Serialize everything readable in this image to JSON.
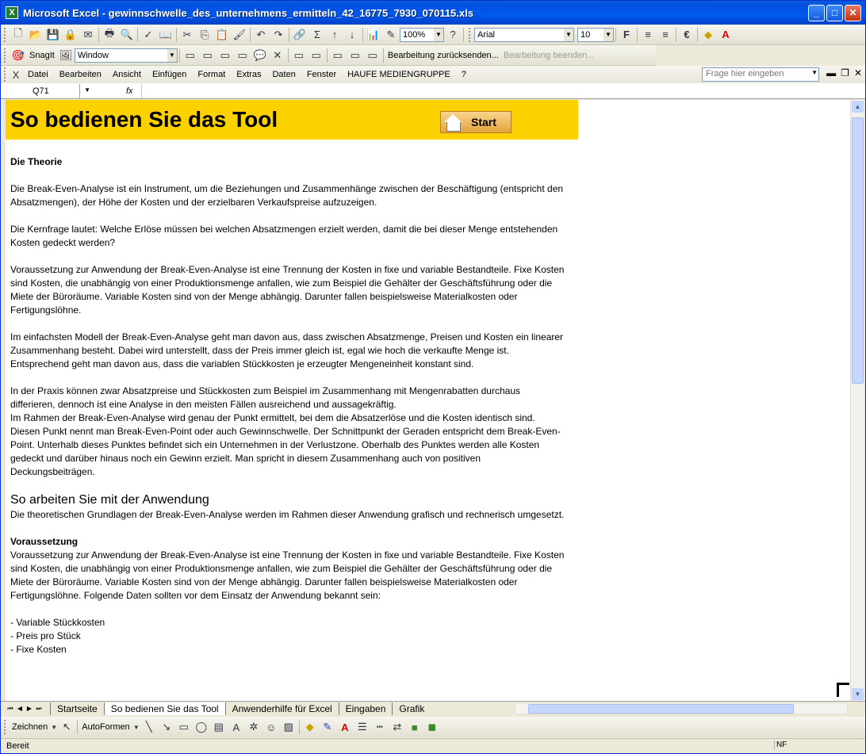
{
  "window": {
    "title": "Microsoft Excel - gewinnschwelle_des_unternehmens_ermitteln_42_16775_7930_070115.xls"
  },
  "toolbar": {
    "zoom": "100%",
    "font": "Arial",
    "font_size": "10",
    "bold_label": "F"
  },
  "snagit_bar": {
    "snagit_label": "SnagIt",
    "window_combo": "Window",
    "review_label": "Bearbeitung zurücksenden...",
    "end_review_label": "Bearbeitung beenden..."
  },
  "menu": {
    "items": [
      "Datei",
      "Bearbeiten",
      "Ansicht",
      "Einfügen",
      "Format",
      "Extras",
      "Daten",
      "Fenster",
      "HAUFE MEDIENGRUPPE",
      "?"
    ],
    "help_placeholder": "Frage hier eingeben"
  },
  "formula_bar": {
    "cell": "Q71",
    "fx": "fx",
    "value": ""
  },
  "banner": {
    "title": "So bedienen Sie das Tool",
    "start_label": "Start"
  },
  "content": {
    "theory_heading": "Die Theorie",
    "p1": "Die Break-Even-Analyse ist ein Instrument, um die Beziehungen und Zusammenhänge zwischen der Beschäftigung (entspricht den Absatzmengen), der Höhe der Kosten und der erzielbaren Verkaufspreise aufzuzeigen.",
    "p2": "Die Kernfrage lautet: Welche Erlöse müssen bei welchen Absatzmengen erzielt werden, damit die bei dieser Menge entstehenden Kosten gedeckt werden?",
    "p3": "Voraussetzung zur Anwendung der Break-Even-Analyse ist eine Trennung der Kosten in fixe und variable Bestandteile. Fixe Kosten sind Kosten, die unabhängig von einer Produktionsmenge anfallen, wie zum Beispiel die Gehälter der Geschäftsführung oder die Miete der Büroräume. Variable Kosten sind von der Menge abhängig. Darunter fallen beispielsweise Materialkosten oder Fertigungslöhne.",
    "p4": "Im einfachsten Modell der Break-Even-Analyse geht man davon aus, dass zwischen Absatzmenge, Preisen und Kosten ein linearer Zusammenhang besteht. Dabei wird unterstellt, dass der Preis immer gleich ist, egal wie hoch die verkaufte Menge ist. Entsprechend geht man davon aus, dass die variablen Stückkosten je erzeugter Mengeneinheit konstant sind.",
    "p5": "In der Praxis können zwar Absatzpreise und Stückkosten zum Beispiel im Zusammenhang mit Mengenrabatten durchaus differieren, dennoch ist eine Analyse in den meisten Fällen ausreichend und aussagekräftig.",
    "p6": "Im Rahmen der Break-Even-Analyse wird genau der Punkt ermittelt, bei dem die Absatzerlöse und die Kosten identisch sind. Diesen Punkt nennt man Break-Even-Point oder auch Gewinnschwelle. Der Schnittpunkt der Geraden entspricht dem Break-Even-Point. Unterhalb dieses Punktes befindet sich ein Unternehmen in der Verlustzone. Oberhalb des Punktes werden alle Kosten gedeckt und darüber hinaus noch ein Gewinn erzielt. Man spricht in diesem Zusammenhang auch von positiven Deckungsbeiträgen.",
    "app_heading": "So arbeiten Sie mit der Anwendung",
    "p7": "Die theoretischen Grundlagen der Break-Even-Analyse werden im Rahmen dieser Anwendung grafisch und rechnerisch umgesetzt.",
    "prereq_heading": "Voraussetzung",
    "p8": "Voraussetzung zur Anwendung der Break-Even-Analyse ist eine Trennung der Kosten in fixe und variable Bestandteile. Fixe Kosten sind Kosten, die unabhängig von einer Produktionsmenge anfallen, wie zum Beispiel die Gehälter der Geschäftsführung oder die Miete der Büroräume. Variable Kosten sind von der Menge abhängig. Darunter fallen beispielsweise Materialkosten oder Fertigungslöhne. Folgende Daten sollten vor dem Einsatz der Anwendung bekannt sein:",
    "list": [
      "- Variable Stückkosten",
      "- Preis pro Stück",
      "- Fixe Kosten"
    ]
  },
  "tabs": [
    "Startseite",
    "So bedienen Sie das Tool",
    "Anwenderhilfe für Excel",
    "Eingaben",
    "Grafik"
  ],
  "drawing_bar": {
    "draw_label": "Zeichnen",
    "autoshapes_label": "AutoFormen"
  },
  "status": {
    "text": "Bereit",
    "nf": "NF"
  }
}
